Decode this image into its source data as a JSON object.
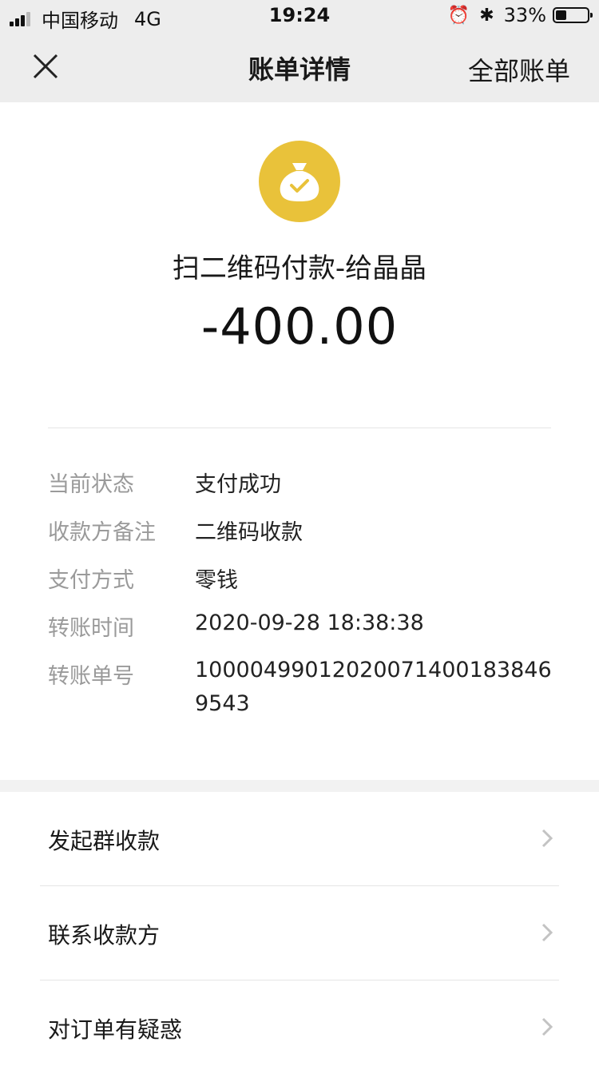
{
  "status_bar": {
    "carrier": "中国移动",
    "network": "4G",
    "time": "19:24",
    "battery_percent": "33%",
    "battery_level": 0.33
  },
  "nav": {
    "title": "账单详情",
    "right_action": "全部账单"
  },
  "transaction": {
    "merchant": "扫二维码付款-给晶晶",
    "amount": "-400.00",
    "icon": "money-bag-icon",
    "icon_color": "#e9c23a"
  },
  "details": [
    {
      "label": "当前状态",
      "value": "支付成功"
    },
    {
      "label": "收款方备注",
      "value": "二维码收款"
    },
    {
      "label": "支付方式",
      "value": "零钱"
    },
    {
      "label": "转账时间",
      "value": "2020-09-28 18:38:38"
    },
    {
      "label": "转账单号",
      "value": "100004990120200714001838469543"
    }
  ],
  "actions": [
    {
      "label": "发起群收款"
    },
    {
      "label": "联系收款方"
    },
    {
      "label": "对订单有疑惑"
    }
  ]
}
